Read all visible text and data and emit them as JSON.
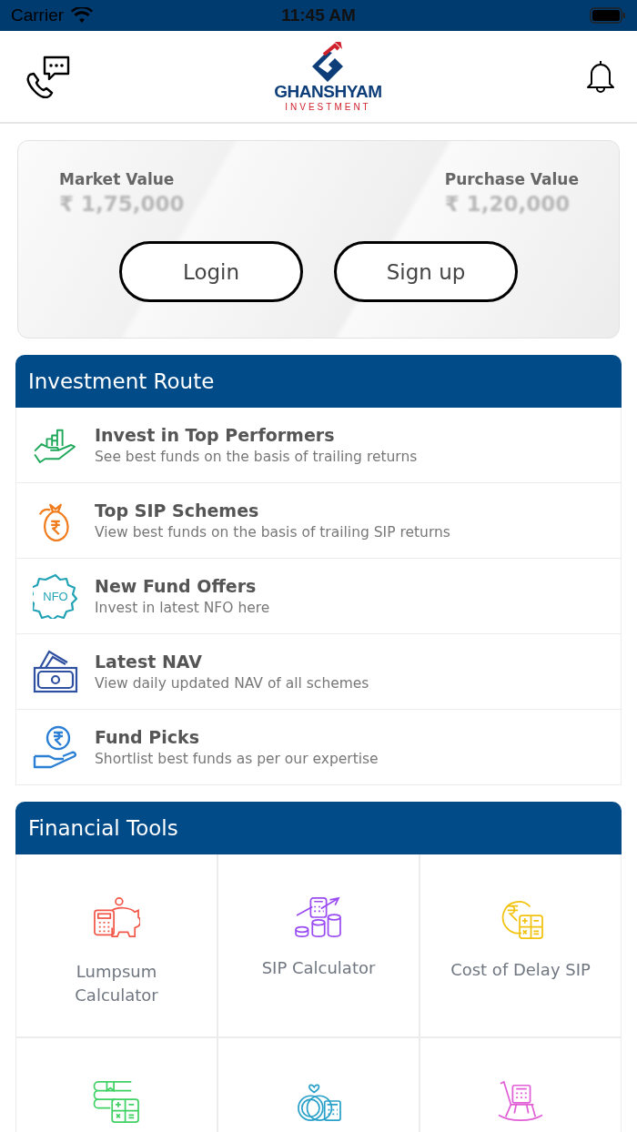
{
  "status_bar": {
    "carrier": "Carrier",
    "time": "11:45 AM"
  },
  "header": {
    "brand": "GHANSHYAM",
    "tagline": "INVESTMENT"
  },
  "portfolio": {
    "market_label": "Market Value",
    "market_value": "₹ 1,75,000",
    "purchase_label": "Purchase Value",
    "purchase_value": "₹ 1,20,000",
    "buttons": [
      "Login",
      "Sign up"
    ]
  },
  "investment_route": {
    "title": "Investment Route",
    "items": [
      {
        "title": "Invest in Top Performers",
        "subtitle": "See best funds on the basis of trailing returns"
      },
      {
        "title": "Top SIP Schemes",
        "subtitle": "View best funds on the basis of trailing SIP returns"
      },
      {
        "title": "New Fund Offers",
        "subtitle": "Invest in latest NFO here",
        "badge": "NFO"
      },
      {
        "title": "Latest NAV",
        "subtitle": "View daily updated NAV of all schemes"
      },
      {
        "title": "Fund Picks",
        "subtitle": "Shortlist best funds as per our expertise"
      }
    ]
  },
  "financial_tools": {
    "title": "Financial Tools",
    "tools": [
      {
        "kind": "piggy-bank",
        "label": "Lumpsum Calculator"
      },
      {
        "kind": "coins",
        "label": "SIP Calculator"
      },
      {
        "kind": "rupee",
        "label": "Cost of Delay SIP"
      },
      {
        "kind": "books"
      },
      {
        "kind": "rings"
      },
      {
        "kind": "rocking-chair"
      }
    ]
  }
}
